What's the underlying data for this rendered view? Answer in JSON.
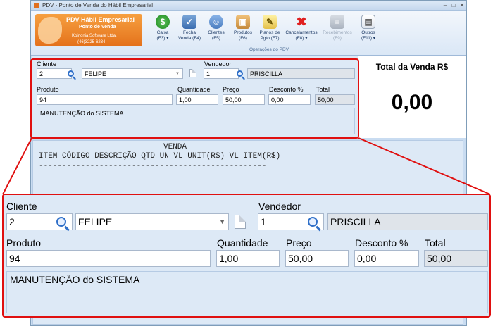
{
  "window": {
    "title": "PDV - Ponto de Venda do Hábil Empresarial"
  },
  "logo": {
    "title": "PDV Hábil Empresarial",
    "subtitle": "Ponto de Venda",
    "company": "Koinonia Software Ltda.",
    "phone": "(46)3225-6234"
  },
  "toolbar": {
    "group_label": "Operações do PDV",
    "items": [
      {
        "label1": "Caixa",
        "label2": "(F3) ▾",
        "icon": "money-icon",
        "enabled": true
      },
      {
        "label1": "Fecha",
        "label2": "Venda (F4)",
        "icon": "close-sale-icon",
        "enabled": true
      },
      {
        "label1": "Clientes",
        "label2": "(F5)",
        "icon": "clients-icon",
        "enabled": true
      },
      {
        "label1": "Produtos",
        "label2": "(F6)",
        "icon": "products-icon",
        "enabled": true
      },
      {
        "label1": "Planos de",
        "label2": "Pgto (F7)",
        "icon": "payment-plans-icon",
        "enabled": true
      },
      {
        "label1": "Cancelamentos",
        "label2": "(F8) ▾",
        "icon": "cancel-icon",
        "enabled": true
      },
      {
        "label1": "Recebimentos",
        "label2": "(F9)",
        "icon": "receipts-icon",
        "enabled": false
      },
      {
        "label1": "Outros",
        "label2": "(F11) ▾",
        "icon": "others-icon",
        "enabled": true
      }
    ]
  },
  "form": {
    "cliente_label": "Cliente",
    "cliente_code": "2",
    "cliente_name": "FELIPE",
    "vendedor_label": "Vendedor",
    "vendedor_code": "1",
    "vendedor_name": "PRISCILLA",
    "produto_label": "Produto",
    "produto_value": "94",
    "quantidade_label": "Quantidade",
    "quantidade_value": "1,00",
    "preco_label": "Preço",
    "preco_value": "50,00",
    "desconto_label": "Desconto %",
    "desconto_value": "0,00",
    "total_label": "Total",
    "total_value": "50,00",
    "description": "MANUTENÇÃO do SISTEMA"
  },
  "total_sale": {
    "label": "Total da Venda R$",
    "value": "0,00"
  },
  "receipt": {
    "title": "VENDA",
    "header": "ITEM CÓDIGO DESCRIÇÃO QTD UN VL UNIT(R$) VL ITEM(R$)",
    "separator": "-------------------------------------------------"
  },
  "colors": {
    "highlight": "#e01010",
    "panel": "#dde9f6",
    "window": "#c9dcf1"
  }
}
